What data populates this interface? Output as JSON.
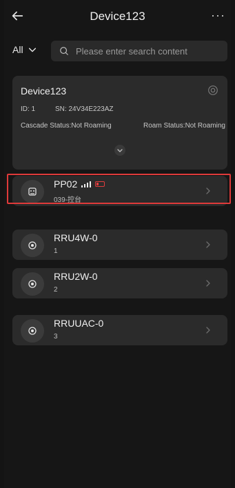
{
  "header": {
    "title": "Device123",
    "back_icon": "arrow-left-icon",
    "more_icon": "more-dots-icon",
    "more_label": "···"
  },
  "filter": {
    "selected": "All",
    "search_placeholder": "Please enter search content"
  },
  "device": {
    "name": "Device123",
    "id": "ID: 1",
    "sn": "SN: 24V34E223AZ",
    "cascade_status": "Cascade Status:Not Roaming",
    "roam_status": "Roam Status:Not Roaming"
  },
  "items": [
    {
      "name": "PP02",
      "sub": "039-控台",
      "icon": "pp-device-icon",
      "signal": "signal-icon",
      "battery": "battery-low-icon"
    },
    {
      "name": "RRU4W-0",
      "sub": "1",
      "icon": "rru-icon"
    },
    {
      "name": "RRU2W-0",
      "sub": "2",
      "icon": "rru-icon"
    },
    {
      "name": "RRUUAC-0",
      "sub": "3",
      "icon": "rru-icon"
    }
  ],
  "colors": {
    "background": "#141414",
    "card": "#2b2b2b",
    "highlight": "#e03a3a"
  }
}
